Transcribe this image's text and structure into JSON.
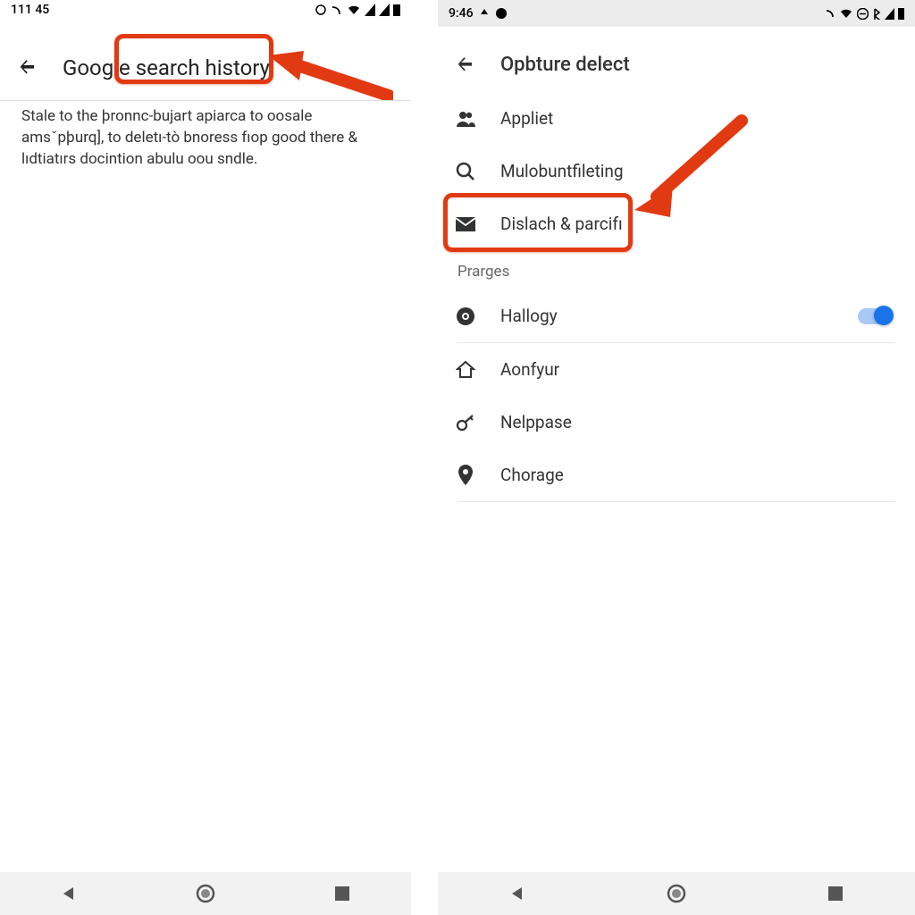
{
  "left": {
    "statusbar": {
      "time": "111 45"
    },
    "header": {
      "title": "Google search history"
    },
    "description": "Stale to the þronnc-bujart apiarca to oosale amsˇpþurq], to deletı-tò bnoress fıop good there & lıdtiatırs docintion abulu oou sndle."
  },
  "right": {
    "statusbar": {
      "time": "9:46"
    },
    "header": {
      "title": "Opbture delect"
    },
    "items_top": [
      {
        "icon": "people",
        "label": "Appliet"
      },
      {
        "icon": "search",
        "label": "Mulobuntfileting"
      },
      {
        "icon": "mail",
        "label": "Dislach & parcifı"
      }
    ],
    "section_label": "Prarges",
    "items_bottom": [
      {
        "icon": "round",
        "label": "Hallogy",
        "toggle": true
      },
      {
        "icon": "home",
        "label": "Aonfyur"
      },
      {
        "icon": "key",
        "label": "Nelppase"
      },
      {
        "icon": "pin",
        "label": "Chorage"
      }
    ]
  }
}
